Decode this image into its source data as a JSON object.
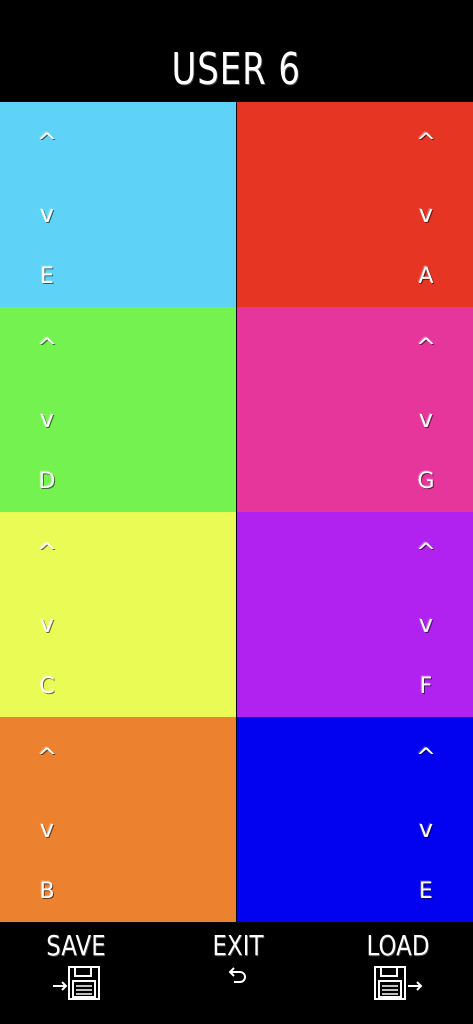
{
  "header": {
    "title": "USER 6"
  },
  "controls": {
    "up": "^",
    "down": "v"
  },
  "cells": [
    {
      "note": "E",
      "color": "#5fd3f7"
    },
    {
      "note": "A",
      "color": "#e73524"
    },
    {
      "note": "D",
      "color": "#74f24f"
    },
    {
      "note": "G",
      "color": "#e6359b"
    },
    {
      "note": "C",
      "color": "#ebfb55"
    },
    {
      "note": "F",
      "color": "#b122f0"
    },
    {
      "note": "B",
      "color": "#ec8130"
    },
    {
      "note": "E",
      "color": "#0202f1"
    }
  ],
  "footer": {
    "save_label": "SAVE",
    "exit_label": "EXIT",
    "load_label": "LOAD"
  }
}
